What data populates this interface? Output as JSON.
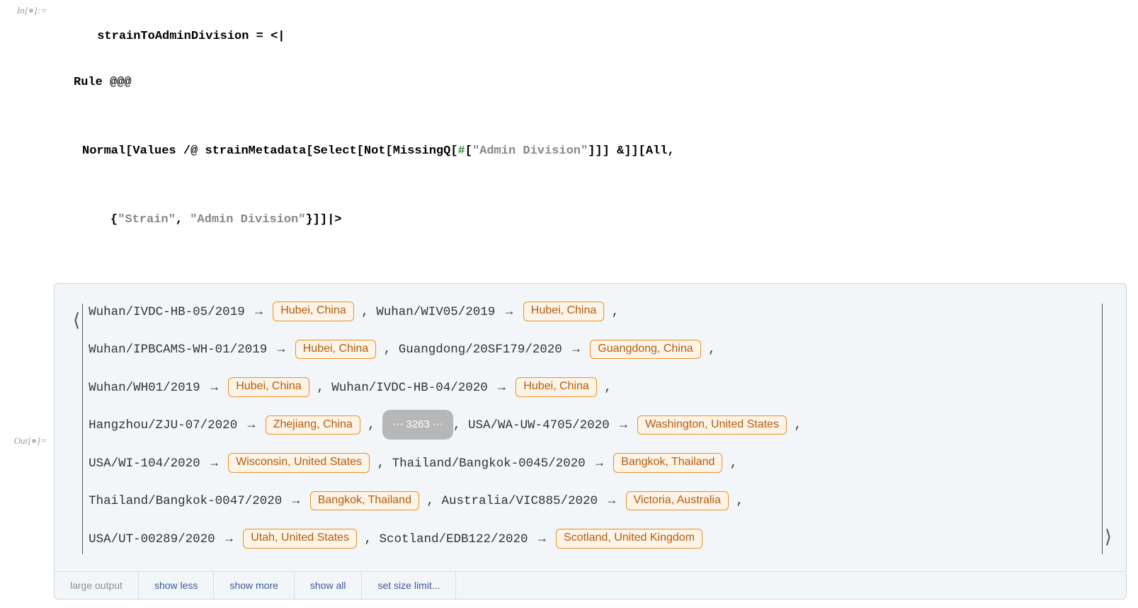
{
  "input": {
    "label_prefix": "In[",
    "label_suffix": "]:=",
    "code": {
      "l1a": "strainToAdminDivision",
      "l1b": " = <|",
      "l2a": "Rule",
      "l2b": " @@@",
      "l3a": "Normal",
      "l3b": "[",
      "l3c": "Values",
      "l3d": " /@ ",
      "l3e": "strainMetadata",
      "l3f": "[",
      "l3g": "Select",
      "l3h": "[",
      "l3i": "Not",
      "l3j": "[",
      "l3k": "MissingQ",
      "l3l": "[",
      "l3m": "#",
      "l3n": "[",
      "l3o": "\"Admin Division\"",
      "l3p": "]]] &]][",
      "l3q": "All",
      "l3r": ",",
      "l4a": "{",
      "l4b": "\"Strain\"",
      "l4c": ", ",
      "l4d": "\"Admin Division\"",
      "l4e": "}]]|>"
    }
  },
  "output": {
    "label_prefix": "Out[",
    "label_suffix": "]=",
    "open_angle": "⟨",
    "close_angle": "⟩",
    "elision": "⋯ 3263 ⋯",
    "entries": [
      {
        "strain": "Wuhan/IVDC-HB-05/2019",
        "entity": "Hubei, China"
      },
      {
        "strain": "Wuhan/WIV05/2019",
        "entity": "Hubei, China"
      },
      {
        "strain": "Wuhan/IPBCAMS-WH-01/2019",
        "entity": "Hubei, China"
      },
      {
        "strain": "Guangdong/20SF179/2020",
        "entity": "Guangdong, China"
      },
      {
        "strain": "Wuhan/WH01/2019",
        "entity": "Hubei, China"
      },
      {
        "strain": "Wuhan/IVDC-HB-04/2020",
        "entity": "Hubei, China"
      },
      {
        "strain": "Hangzhou/ZJU-07/2020",
        "entity": "Zhejiang, China"
      },
      {
        "strain": "USA/WA-UW-4705/2020",
        "entity": "Washington, United States"
      },
      {
        "strain": "USA/WI-104/2020",
        "entity": "Wisconsin, United States"
      },
      {
        "strain": "Thailand/Bangkok-0045/2020",
        "entity": "Bangkok, Thailand"
      },
      {
        "strain": "Thailand/Bangkok-0047/2020",
        "entity": "Bangkok, Thailand"
      },
      {
        "strain": "Australia/VIC885/2020",
        "entity": "Victoria, Australia"
      },
      {
        "strain": "USA/UT-00289/2020",
        "entity": "Utah, United States"
      },
      {
        "strain": "Scotland/EDB122/2020",
        "entity": "Scotland, United Kingdom"
      }
    ],
    "footer": {
      "label": "large output",
      "show_less": "show less",
      "show_more": "show more",
      "show_all": "show all",
      "set_limit": "set size limit..."
    }
  }
}
